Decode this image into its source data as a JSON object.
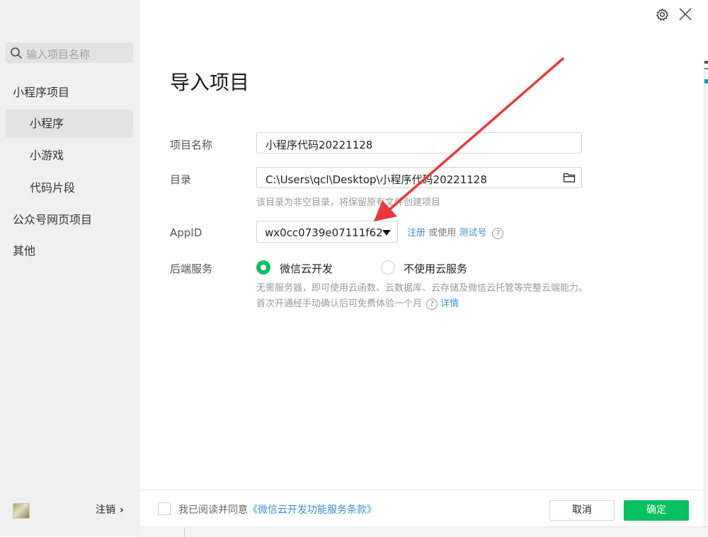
{
  "sidebar": {
    "search_placeholder": "输入项目名称",
    "sections": [
      {
        "label": "小程序项目"
      },
      {
        "label": "小程序"
      },
      {
        "label": "小游戏"
      },
      {
        "label": "代码片段"
      },
      {
        "label": "公众号网页项目"
      },
      {
        "label": "其他"
      }
    ],
    "logout_label": "注销",
    "logout_chevron": "›"
  },
  "dialog": {
    "title": "导入项目",
    "project_name": {
      "label": "项目名称",
      "value": "小程序代码20221128"
    },
    "directory": {
      "label": "目录",
      "value": "C:\\Users\\qcl\\Desktop\\小程序代码20221128",
      "hint": "该目录为非空目录，将保留原有文件创建项目"
    },
    "appid": {
      "label": "AppID",
      "value": "wx0cc0739e07111f62",
      "register_link": "注册",
      "or_use": "或使用",
      "test_link": "测试号",
      "help_glyph": "?"
    },
    "backend": {
      "label": "后端服务",
      "options": [
        {
          "label": "微信云开发",
          "selected": true
        },
        {
          "label": "不使用云服务",
          "selected": false
        }
      ],
      "description": "无需服务器，即可使用云函数、云数据库、云存储及微信云托管等完整云端能力。 首次开通经手动确认后可免费体验一个月",
      "details_link": "详情",
      "help_glyph": "?"
    }
  },
  "footer": {
    "agree_text": "我已阅读并同意",
    "agree_link": "《微信云开发功能服务条款》",
    "cancel_label": "取消",
    "confirm_label": "确定"
  },
  "colors": {
    "accent_green": "#07c160",
    "link_blue": "#3d8fd6",
    "annotation_red": "#e8383d",
    "sidebar_bg": "#f0f0f0"
  }
}
